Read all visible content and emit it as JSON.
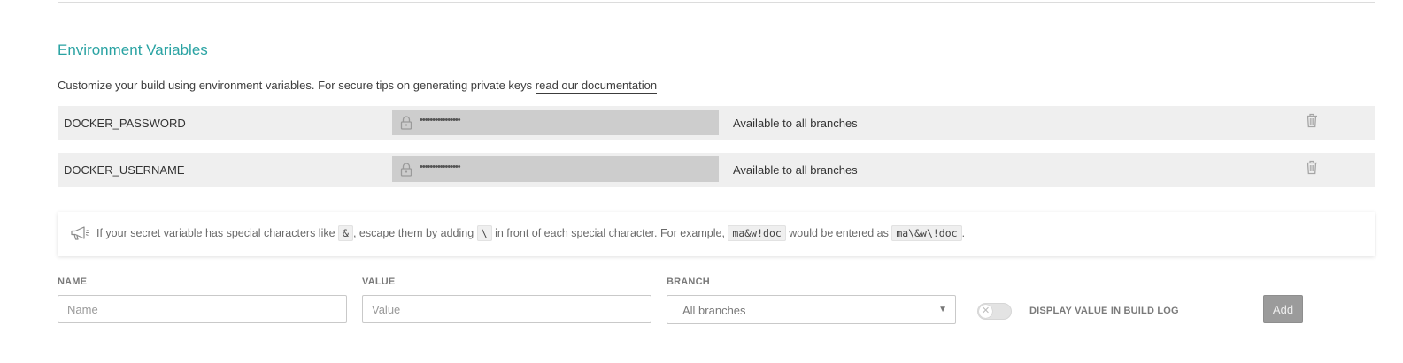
{
  "section": {
    "title": "Environment Variables",
    "description": "Customize your build using environment variables. For secure tips on generating private keys ",
    "doc_link": "read our documentation"
  },
  "variables": [
    {
      "name": "DOCKER_PASSWORD",
      "value": "••••••••••••••••",
      "branch": "Available to all branches"
    },
    {
      "name": "DOCKER_USERNAME",
      "value": "••••••••••••••••",
      "branch": "Available to all branches"
    }
  ],
  "notice": {
    "t1": "If your secret variable has special characters like ",
    "c1": "&",
    "t2": ", escape them by adding ",
    "c2": "\\",
    "t3": " in front of each special character. For example, ",
    "c3": "ma&w!doc",
    "t4": " would be entered as ",
    "c4": "ma\\&w\\!doc",
    "t5": "."
  },
  "form": {
    "name_label": "NAME",
    "name_placeholder": "Name",
    "value_label": "VALUE",
    "value_placeholder": "Value",
    "branch_label": "BRANCH",
    "branch_selected": "All branches",
    "display_toggle_label": "DISPLAY VALUE IN BUILD LOG",
    "display_toggle_on": false,
    "add_label": "Add"
  }
}
